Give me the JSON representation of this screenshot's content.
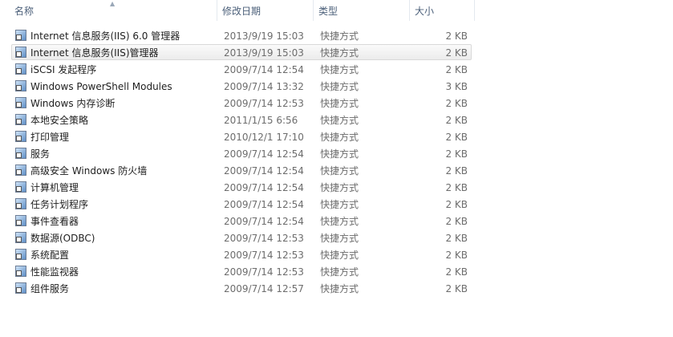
{
  "columns": {
    "name": "名称",
    "date": "修改日期",
    "type": "类型",
    "size": "大小"
  },
  "rows": [
    {
      "name": "Internet 信息服务(IIS) 6.0 管理器",
      "date": "2013/9/19 15:03",
      "type": "快捷方式",
      "size": "2 KB"
    },
    {
      "name": "Internet 信息服务(IIS)管理器",
      "date": "2013/9/19 15:03",
      "type": "快捷方式",
      "size": "2 KB"
    },
    {
      "name": "iSCSI 发起程序",
      "date": "2009/7/14 12:54",
      "type": "快捷方式",
      "size": "2 KB"
    },
    {
      "name": "Windows PowerShell Modules",
      "date": "2009/7/14 13:32",
      "type": "快捷方式",
      "size": "3 KB"
    },
    {
      "name": "Windows 内存诊断",
      "date": "2009/7/14 12:53",
      "type": "快捷方式",
      "size": "2 KB"
    },
    {
      "name": "本地安全策略",
      "date": "2011/1/15 6:56",
      "type": "快捷方式",
      "size": "2 KB"
    },
    {
      "name": "打印管理",
      "date": "2010/12/1 17:10",
      "type": "快捷方式",
      "size": "2 KB"
    },
    {
      "name": "服务",
      "date": "2009/7/14 12:54",
      "type": "快捷方式",
      "size": "2 KB"
    },
    {
      "name": "高级安全 Windows 防火墙",
      "date": "2009/7/14 12:54",
      "type": "快捷方式",
      "size": "2 KB"
    },
    {
      "name": "计算机管理",
      "date": "2009/7/14 12:54",
      "type": "快捷方式",
      "size": "2 KB"
    },
    {
      "name": "任务计划程序",
      "date": "2009/7/14 12:54",
      "type": "快捷方式",
      "size": "2 KB"
    },
    {
      "name": "事件查看器",
      "date": "2009/7/14 12:54",
      "type": "快捷方式",
      "size": "2 KB"
    },
    {
      "name": "数据源(ODBC)",
      "date": "2009/7/14 12:53",
      "type": "快捷方式",
      "size": "2 KB"
    },
    {
      "name": "系统配置",
      "date": "2009/7/14 12:53",
      "type": "快捷方式",
      "size": "2 KB"
    },
    {
      "name": "性能监视器",
      "date": "2009/7/14 12:53",
      "type": "快捷方式",
      "size": "2 KB"
    },
    {
      "name": "组件服务",
      "date": "2009/7/14 12:57",
      "type": "快捷方式",
      "size": "2 KB"
    }
  ],
  "hovered_index": 1
}
